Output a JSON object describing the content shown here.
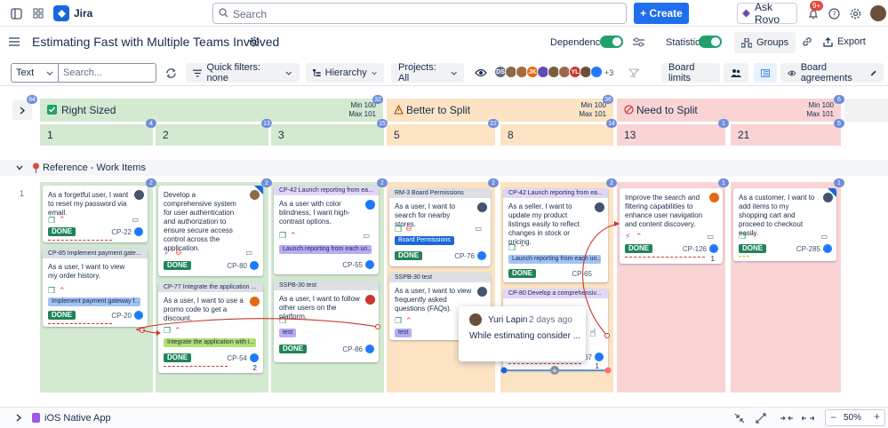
{
  "app": {
    "name": "Jira"
  },
  "search": {
    "placeholder": "Search"
  },
  "create_label": "+ Create",
  "rovo_label": "Ask Rovo",
  "notifications_badge": "9+",
  "board": {
    "title": "Estimating Fast with Multiple Teams Involved",
    "dependencies_label": "Dependencies",
    "statistics_label": "Statistics",
    "groups_label": "Groups",
    "export_label": "Export"
  },
  "toolbar": {
    "text_select": "Text",
    "search_placeholder": "Search...",
    "quick_filters": "Quick filters: none",
    "hierarchy": "Hierarchy",
    "projects": "Projects: All",
    "avatars_more": "+3",
    "board_limits": "Board limits",
    "board_agreements": "Board agreements"
  },
  "avatars": [
    {
      "initials": "DS",
      "color": "#626f86"
    },
    {
      "initials": "",
      "color": "#8c6b4a"
    },
    {
      "initials": "",
      "color": "#a36b3a"
    },
    {
      "initials": "JK",
      "color": "#e56910"
    },
    {
      "initials": "",
      "color": "#5e4db2"
    },
    {
      "initials": "",
      "color": "#7a5c3e"
    },
    {
      "initials": "",
      "color": "#9b6a4a"
    },
    {
      "initials": "YL",
      "color": "#c9372c"
    },
    {
      "initials": "",
      "color": "#6b4f3a"
    },
    {
      "initials": "",
      "color": "#1d7afc"
    }
  ],
  "bands": [
    {
      "label": "Right Sized",
      "count": "84",
      "min": "Min 100",
      "max": "Max 101",
      "color": "#d3e9d0"
    },
    {
      "label": "Better to Split",
      "count": "32",
      "min": "Min 100",
      "max": "Max 101",
      "color": "#fbe3c4",
      "count2": "36"
    },
    {
      "label": "Need to Split",
      "count": "6",
      "min": "Min 100",
      "max": "Max 101",
      "color": "#fad4d4"
    }
  ],
  "estimates": [
    {
      "value": "1",
      "count": "4"
    },
    {
      "value": "2",
      "count": "13"
    },
    {
      "value": "3",
      "count": "15"
    },
    {
      "value": "5",
      "count": "22"
    },
    {
      "value": "8",
      "count": "14"
    },
    {
      "value": "13",
      "count": "1"
    },
    {
      "value": "21",
      "count": "5"
    }
  ],
  "groups": {
    "reference": "Reference - Work Items",
    "ios": "iOS Native App",
    "row_number": "1"
  },
  "column_counts": [
    "2",
    "2",
    "2",
    "2",
    "2",
    "1",
    "1"
  ],
  "cards": {
    "c1a": {
      "text": "As a forgetful user, I want to reset my password via email.",
      "status": "DONE",
      "key": "CP-22"
    },
    "c1b": {
      "parent": "CP-85 Implement payment gate...",
      "text": "As a user, I want to view my order history.",
      "tag": "Implement payment gateway f...",
      "status": "DONE",
      "key": "CP-20"
    },
    "c2a": {
      "text": "Develop a comprehensive system for user authentication and authorization to ensure secure access control across the application.",
      "status": "DONE",
      "key": "CP-80"
    },
    "c2b": {
      "parent": "CP-77 Integrate the application ...",
      "text": "As a user, I want to use a promo code to get a discount.",
      "tag": "Integrate the application with i...",
      "status": "DONE",
      "key": "CP-54",
      "count": "2"
    },
    "c3a": {
      "parent": "CP-42 Launch reporting from ea...",
      "text": "As a user with color blindness, I want high-contrast options.",
      "tag": "Launch reporting from each un...",
      "key": "CP-55"
    },
    "c3b": {
      "parent": "SSPB-30 test",
      "text": "As a user, I want to follow other users on the platform.",
      "tag": "test",
      "status": "DONE",
      "key": "CP-86"
    },
    "c4a": {
      "parent": "RM-3 Board Permissions",
      "text": "As a user, I want to search for nearby stores.",
      "tag": "Board Permissions",
      "status": "DONE",
      "key": "CP-76"
    },
    "c4b": {
      "parent": "SSPB-30 test",
      "text": "As a user, I want to view frequently asked questions (FAQs).",
      "tag": "test"
    },
    "c5a": {
      "parent": "CP-42 Launch reporting from ea...",
      "text": "As a seller, I want to update my product listings easily to reflect changes in stock or pricing.",
      "tag": "Launch reporting from each un...",
      "status": "DONE",
      "key": "CP-65"
    },
    "c5b": {
      "parent": "CP-80 Develop a comprehensiv...",
      "key": "-67",
      "count": "1"
    },
    "c6a": {
      "text": "Improve the search and filtering capabilities to enhance user navigation and content discovery.",
      "status": "DONE",
      "key": "CP-126",
      "count": "1"
    },
    "c7a": {
      "text": "As a customer, I want to add items to my shopping cart and proceed to checkout easily.",
      "status": "DONE",
      "key": "CP-285"
    }
  },
  "tooltip": {
    "name": "Yuri Lapin",
    "time": "2 days ago",
    "text": "While estimating consider ..."
  },
  "zoom": "50%"
}
